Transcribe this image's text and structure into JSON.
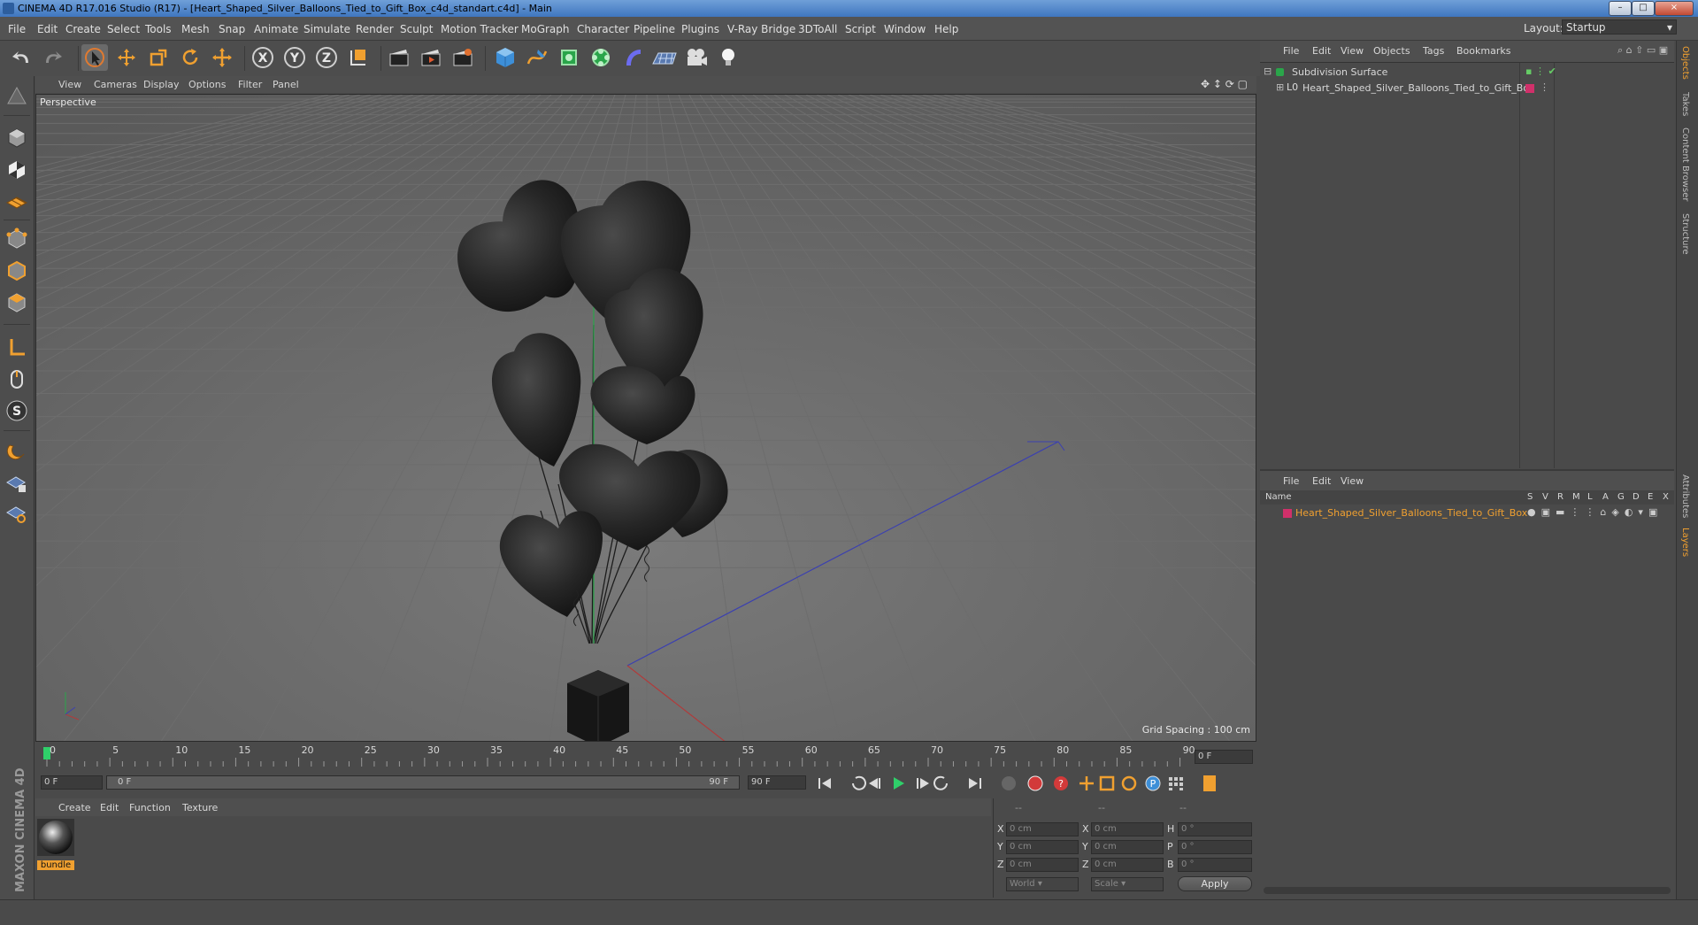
{
  "window": {
    "title": "CINEMA 4D R17.016 Studio (R17) - [Heart_Shaped_Silver_Balloons_Tied_to_Gift_Box_c4d_standart.c4d] - Main",
    "min": "–",
    "max": "□",
    "close": "×"
  },
  "menu": [
    "File",
    "Edit",
    "Create",
    "Select",
    "Tools",
    "Mesh",
    "Snap",
    "Animate",
    "Simulate",
    "Render",
    "Sculpt",
    "Motion Tracker",
    "MoGraph",
    "Character",
    "Pipeline",
    "Plugins",
    "V-Ray Bridge",
    "3DToAll",
    "Script",
    "Window",
    "Help"
  ],
  "layout": {
    "label": "Layout:",
    "value": "Startup"
  },
  "toolbar": {
    "x_label": "X",
    "y_label": "Y",
    "z_label": "Z"
  },
  "viewport": {
    "menu": [
      "View",
      "Cameras",
      "Display",
      "Options",
      "Filter",
      "Panel"
    ],
    "label": "Perspective",
    "grid_spacing": "Grid Spacing : 100 cm"
  },
  "timeline": {
    "ticks": [
      "0",
      "5",
      "10",
      "15",
      "20",
      "25",
      "30",
      "35",
      "40",
      "45",
      "50",
      "55",
      "60",
      "65",
      "70",
      "75",
      "80",
      "85",
      "90"
    ],
    "current_frame": "0 F",
    "start_field": "0 F",
    "range_start": "0 F",
    "range_end": "90 F",
    "end_field": "90 F"
  },
  "material_manager": {
    "menu": [
      "Create",
      "Edit",
      "Function",
      "Texture"
    ],
    "material_name": "bundle"
  },
  "coords": {
    "header": [
      "--",
      "--",
      "--"
    ],
    "rows": [
      {
        "a": "X",
        "av": "0 cm",
        "b": "X",
        "bv": "0 cm",
        "c": "H",
        "cv": "0 °"
      },
      {
        "a": "Y",
        "av": "0 cm",
        "b": "Y",
        "bv": "0 cm",
        "c": "P",
        "cv": "0 °"
      },
      {
        "a": "Z",
        "av": "0 cm",
        "b": "Z",
        "bv": "0 cm",
        "c": "B",
        "cv": "0 °"
      }
    ],
    "world": "World",
    "scale": "Scale",
    "apply": "Apply"
  },
  "objects": {
    "menu": [
      "File",
      "Edit",
      "View",
      "Objects",
      "Tags",
      "Bookmarks"
    ],
    "items": [
      "Subdivision Surface",
      "Heart_Shaped_Silver_Balloons_Tied_to_Gift_Box"
    ]
  },
  "layers": {
    "menu": [
      "File",
      "Edit",
      "View"
    ],
    "name_col": "Name",
    "cols": [
      "S",
      "V",
      "R",
      "M",
      "L",
      "A",
      "G",
      "D",
      "E",
      "X"
    ],
    "item": "Heart_Shaped_Silver_Balloons_Tied_to_Gift_Box"
  },
  "right_tabs": [
    "Objects",
    "Takes",
    "Content Browser",
    "Structure",
    "Attributes",
    "Layers"
  ],
  "brand": "MAXON CINEMA 4D",
  "colors": {
    "accent": "#f0a030",
    "layer_red": "#d0306a",
    "title_blue": "#4a80c8"
  }
}
